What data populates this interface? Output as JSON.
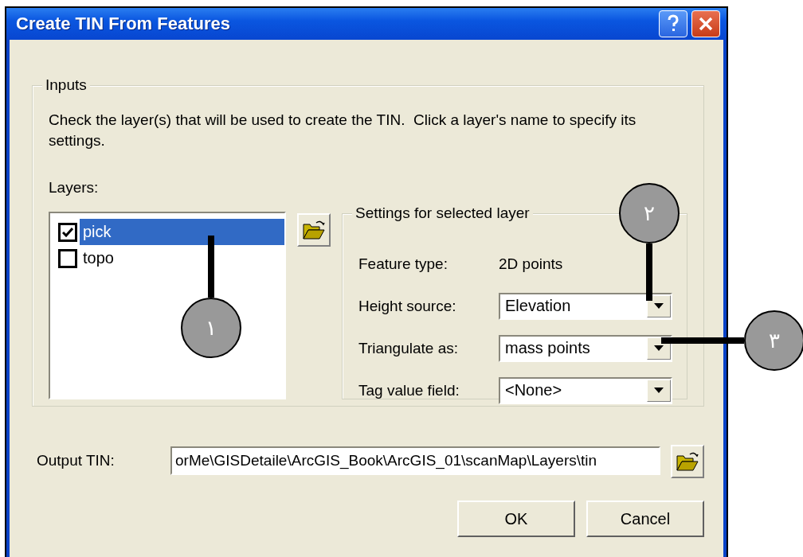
{
  "window": {
    "title": "Create TIN From Features"
  },
  "inputs": {
    "legend": "Inputs",
    "instruction": "Check the layer(s) that will be used to create the TIN.  Click a layer's name to specify its settings.",
    "layers_label": "Layers:",
    "layers": [
      {
        "name": "pick",
        "checked": true,
        "selected": true
      },
      {
        "name": "topo",
        "checked": false,
        "selected": false
      }
    ]
  },
  "settings": {
    "legend": "Settings for selected layer",
    "feature_type": {
      "label": "Feature type:",
      "value": "2D points"
    },
    "fields": [
      {
        "label": "Height source:",
        "value": "Elevation"
      },
      {
        "label": "Triangulate as:",
        "value": "mass points"
      },
      {
        "label": "Tag value field:",
        "value": "<None>"
      }
    ]
  },
  "output": {
    "label": "Output TIN:",
    "value": "orMe\\GISDetaile\\ArcGIS_Book\\ArcGIS_01\\scanMap\\Layers\\tin"
  },
  "buttons": [
    "OK",
    "Cancel"
  ],
  "callouts": [
    {
      "label": "١"
    },
    {
      "label": "٢"
    },
    {
      "label": "٣"
    }
  ]
}
